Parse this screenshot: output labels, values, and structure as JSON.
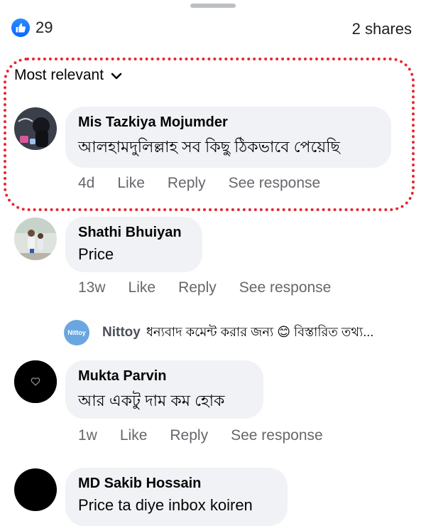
{
  "header": {
    "reaction_count": "29",
    "shares": "2 shares",
    "like_color": "#0866ff"
  },
  "sort": {
    "label": "Most relevant"
  },
  "comments": [
    {
      "author": "Mis Tazkiya Mojumder",
      "text": "আলহামদুলিল্লাহ সব কিছু ঠিকভাবে পেয়েছি",
      "time": "4d",
      "like": "Like",
      "reply": "Reply",
      "see_response": "See response"
    },
    {
      "author": "Shathi Bhuiyan",
      "text": "Price",
      "time": "13w",
      "like": "Like",
      "reply": "Reply",
      "see_response": "See response"
    },
    {
      "author": "Mukta Parvin",
      "text": "আর একটু দাম কম হোক",
      "time": "1w",
      "like": "Like",
      "reply": "Reply",
      "see_response": "See response"
    },
    {
      "author": "MD Sakib Hossain",
      "text": "Price ta diye inbox koiren"
    }
  ],
  "reply_preview": {
    "avatar_label": "Nittoy",
    "author": "Nittoy",
    "text": "ধন্যবাদ কমেন্ট করার জন্য 😊 বিস্তারিত তথ্য..."
  },
  "highlight_color": "#e8252f"
}
